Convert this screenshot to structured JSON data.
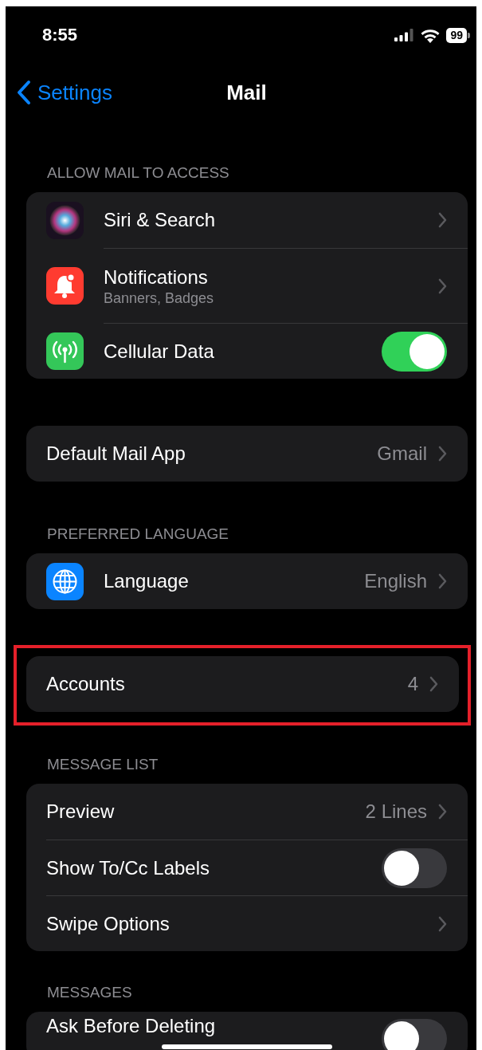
{
  "status_bar": {
    "time": "8:55",
    "battery": "99"
  },
  "nav": {
    "back": "Settings",
    "title": "Mail"
  },
  "sections": [
    {
      "header": "ALLOW MAIL TO ACCESS",
      "highlighted": false,
      "rows": [
        {
          "kind": "nav",
          "label": "Siri & Search"
        },
        {
          "kind": "nav",
          "label": "Notifications",
          "subtitle": "Banners, Badges"
        },
        {
          "kind": "toggle",
          "label": "Cellular Data",
          "on": true
        }
      ]
    },
    {
      "highlighted": false,
      "rows": [
        {
          "kind": "nav",
          "label": "Default Mail App",
          "value": "Gmail"
        }
      ]
    },
    {
      "header": "PREFERRED LANGUAGE",
      "highlighted": false,
      "rows": [
        {
          "kind": "nav",
          "label": "Language",
          "value": "English"
        }
      ]
    },
    {
      "highlighted": true,
      "rows": [
        {
          "kind": "nav",
          "label": "Accounts",
          "value": "4"
        }
      ]
    },
    {
      "header": "MESSAGE LIST",
      "highlighted": false,
      "rows": [
        {
          "kind": "nav",
          "label": "Preview",
          "value": "2 Lines"
        },
        {
          "kind": "toggle",
          "label": "Show To/Cc Labels",
          "on": false
        },
        {
          "kind": "nav",
          "label": "Swipe Options"
        }
      ]
    },
    {
      "header": "MESSAGES",
      "highlighted": false,
      "rows": [
        {
          "kind": "toggle",
          "label": "Ask Before Deleting",
          "on": false
        }
      ]
    }
  ]
}
